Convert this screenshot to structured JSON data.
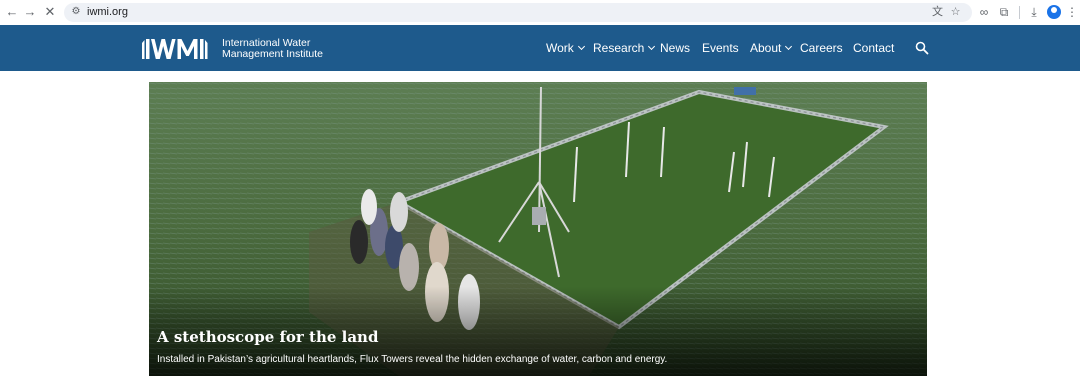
{
  "browser": {
    "url": "iwmi.org",
    "icons": {
      "back": "back-arrow-icon",
      "forward": "forward-arrow-icon",
      "stop": "close-icon",
      "site_info": "tune-icon",
      "translate": "translate-icon",
      "bookmark": "star-icon",
      "link": "link-icon",
      "extensions": "puzzle-icon",
      "downloads": "download-icon",
      "profile": "profile-icon",
      "menu": "kebab-menu-icon"
    }
  },
  "header": {
    "bg_color": "#1e5a8c",
    "logo_mark": "IWMI",
    "logo_line1": "International Water",
    "logo_line2": "Management Institute",
    "nav": [
      {
        "label": "Work",
        "dropdown": true
      },
      {
        "label": "Research",
        "dropdown": true
      },
      {
        "label": "News",
        "dropdown": false
      },
      {
        "label": "Events",
        "dropdown": false
      },
      {
        "label": "About",
        "dropdown": true
      },
      {
        "label": "Careers",
        "dropdown": false
      },
      {
        "label": "Contact",
        "dropdown": false
      }
    ],
    "search_icon": "search-icon"
  },
  "hero": {
    "title": "A stethoscope for the land",
    "subtitle": "Installed in Pakistan’s agricultural heartlands, Flux Towers reveal the hidden exchange of water, carbon and energy."
  }
}
